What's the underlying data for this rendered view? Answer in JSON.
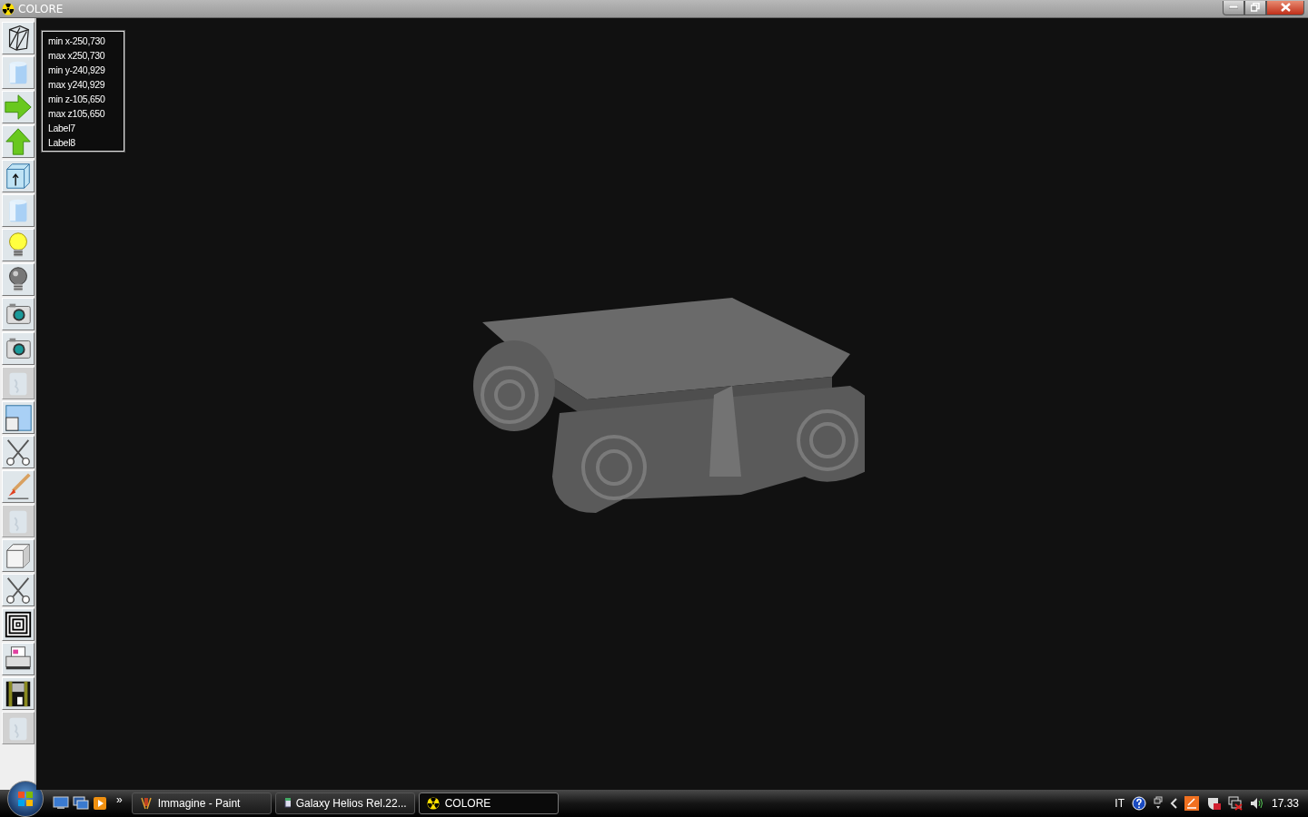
{
  "window": {
    "title": "COLORE"
  },
  "toolbar": [
    {
      "kind": "wireframe",
      "disabled": false
    },
    {
      "kind": "cylinder",
      "disabled": false
    },
    {
      "kind": "arrow-right",
      "disabled": false
    },
    {
      "kind": "arrow-up",
      "disabled": false
    },
    {
      "kind": "cube-arrow",
      "disabled": false
    },
    {
      "kind": "cylinder",
      "disabled": false
    },
    {
      "kind": "bulb-on",
      "disabled": false
    },
    {
      "kind": "bulb-off",
      "disabled": false
    },
    {
      "kind": "camera",
      "disabled": false
    },
    {
      "kind": "camera",
      "disabled": false
    },
    {
      "kind": "blank",
      "disabled": true
    },
    {
      "kind": "window",
      "disabled": false
    },
    {
      "kind": "scissors",
      "disabled": false
    },
    {
      "kind": "brush",
      "disabled": false
    },
    {
      "kind": "blank",
      "disabled": true
    },
    {
      "kind": "cube",
      "disabled": false
    },
    {
      "kind": "scissors",
      "disabled": false
    },
    {
      "kind": "squares",
      "disabled": false
    },
    {
      "kind": "printer",
      "disabled": false
    },
    {
      "kind": "floppy",
      "disabled": false
    },
    {
      "kind": "blank",
      "disabled": true
    }
  ],
  "info_panel": {
    "lines": [
      "min x-250,730",
      "max x250,730",
      "min y-240,929",
      "max y240,929",
      "min z-105,650",
      "max z105,650",
      "Label7",
      "Label8"
    ]
  },
  "taskbar": {
    "more": "»",
    "tasks": [
      {
        "label": "Immagine - Paint",
        "kind": "paint",
        "selected": false
      },
      {
        "label": "Galaxy Helios  Rel.22...",
        "kind": "helios",
        "selected": false
      },
      {
        "label": "COLORE",
        "kind": "colore",
        "selected": true
      }
    ],
    "language": "IT",
    "clock": "17.33"
  }
}
